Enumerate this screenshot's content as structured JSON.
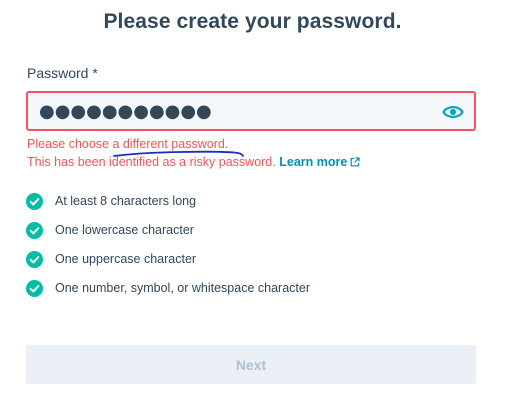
{
  "heading": "Please create your password.",
  "password_field": {
    "label": "Password *",
    "masked_value": "●●●●●●●●●●●",
    "state": "error",
    "border_color": "#f2545b",
    "toggle_icon": "eye-icon"
  },
  "errors": {
    "line1": "Please choose a different password.",
    "line2": "This has been identified as a risky password.",
    "learn_more": "Learn more",
    "color": "#f2545b"
  },
  "requirements": [
    {
      "text": "At least 8 characters long",
      "met": true
    },
    {
      "text": "One lowercase character",
      "met": true
    },
    {
      "text": "One uppercase character",
      "met": true
    },
    {
      "text": "One number, symbol, or whitespace character",
      "met": true
    }
  ],
  "next_button": {
    "label": "Next",
    "disabled": true
  },
  "colors": {
    "text": "#33475b",
    "accent": "#00bda5",
    "link": "#0091ae",
    "annotation": "#1a2fb8"
  }
}
